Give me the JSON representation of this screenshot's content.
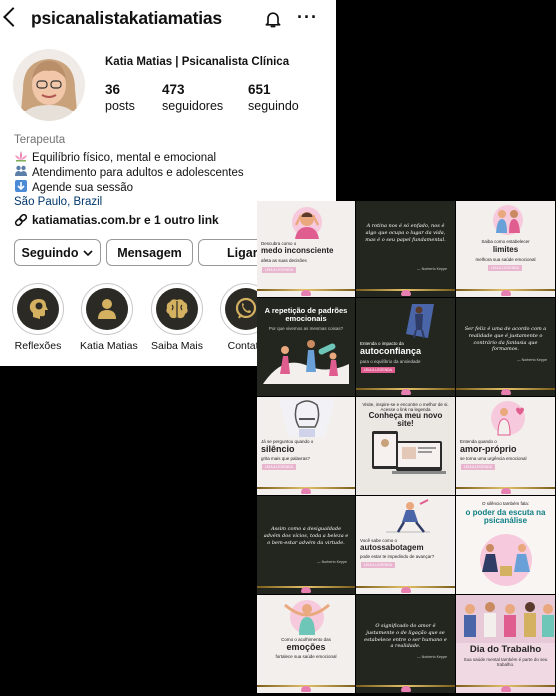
{
  "profile": {
    "username": "psicanalistakatiamatias",
    "full_name": "Katia Matias | Psicanalista Clínica",
    "stats": [
      {
        "value": "36",
        "label": "posts"
      },
      {
        "value": "473",
        "label": "seguidores"
      },
      {
        "value": "651",
        "label": "seguindo"
      }
    ],
    "category": "Terapeuta",
    "bio": [
      "Equilíbrio físico, mental e emocional",
      "Atendimento para adultos e adolescentes",
      "Agende sua sessão"
    ],
    "location": "São Paulo, Brazil",
    "link": "katiamatias.com.br e 1 outro link"
  },
  "buttons": {
    "following": "Seguindo",
    "message": "Mensagem",
    "call": "Ligar"
  },
  "highlights": [
    "Reflexões",
    "Katia Matias",
    "Saiba Mais",
    "Contato"
  ],
  "posts": {
    "p1": {
      "pre": "Descubra como o",
      "title": "medo inconsciente",
      "sub": "afeta as suas decisões",
      "btn": "LEIA A LEGENDA"
    },
    "p2": {
      "quote": "A rotina nos é só enfado, nos é algo que ocupa o lugar da vida, mas é o seu papel fundamental.",
      "author": "— Norberto Keppe"
    },
    "p3": {
      "pre": "Saiba como estabelecer",
      "title": "limites",
      "sub": "melhora sua saúde emocional",
      "btn": "LEIA A LEGENDA"
    },
    "p4": {
      "title": "A repetição de padrões emocionais",
      "sub": "Por que vivemos as mesmas coisas?"
    },
    "p5": {
      "pre": "Entenda o impacto da",
      "title": "autoconfiança",
      "sub": "para o equilíbrio da ansiedade",
      "btn": "LEIA A LEGENDA"
    },
    "p6": {
      "quote": "Ser feliz é uma de acordo com a realidade que é justamente o contrário da fantasia que formamos.",
      "author": "— Norberto Keppe"
    },
    "p7": {
      "pre": "Já se perguntou quando o",
      "title": "silêncio",
      "sub": "grita mais que palavras?",
      "btn": "LEIA A LEGENDA"
    },
    "p8": {
      "pre": "Visite, inspire-se e encontre o melhor de si. Acesse o link na legenda",
      "title": "Conheça meu novo site!"
    },
    "p9": {
      "pre": "Entenda quando o",
      "title": "amor-próprio",
      "sub": "se torna uma urgência emocional",
      "btn": "LEIA A LEGENDA"
    },
    "p10": {
      "quote": "Assim como a desigualdade advém dos vícios, toda a beleza e o bem-estar advém da virtude.",
      "author": "— Norberto Keppe"
    },
    "p11": {
      "pre": "Você sabe como o",
      "title": "autossabotagem",
      "sub": "pode estar te impedindo de avançar?",
      "btn": "LEIA A LEGENDA"
    },
    "p12": {
      "pre": "O silêncio também fala:",
      "title": "o poder da escuta na psicanálise"
    },
    "p13": {
      "pre": "Como o acolhimento das",
      "title": "emoções",
      "sub": "fortalece sua saúde emocional"
    },
    "p14": {
      "quote": "O significado do amor é justamente o de ligação que se estabelece entre o ser humano e a realidade.",
      "author": "— Norberto Keppe"
    },
    "p15": {
      "title": "Dia do Trabalho",
      "sub": "Sua saúde mental também é parte do seu trabalho."
    }
  },
  "colors": {
    "accent_link": "#00376b",
    "gold": "#d4b061",
    "dark_bg": "#23261f",
    "pink": "#e77fb1",
    "teal": "#0e7f86"
  }
}
